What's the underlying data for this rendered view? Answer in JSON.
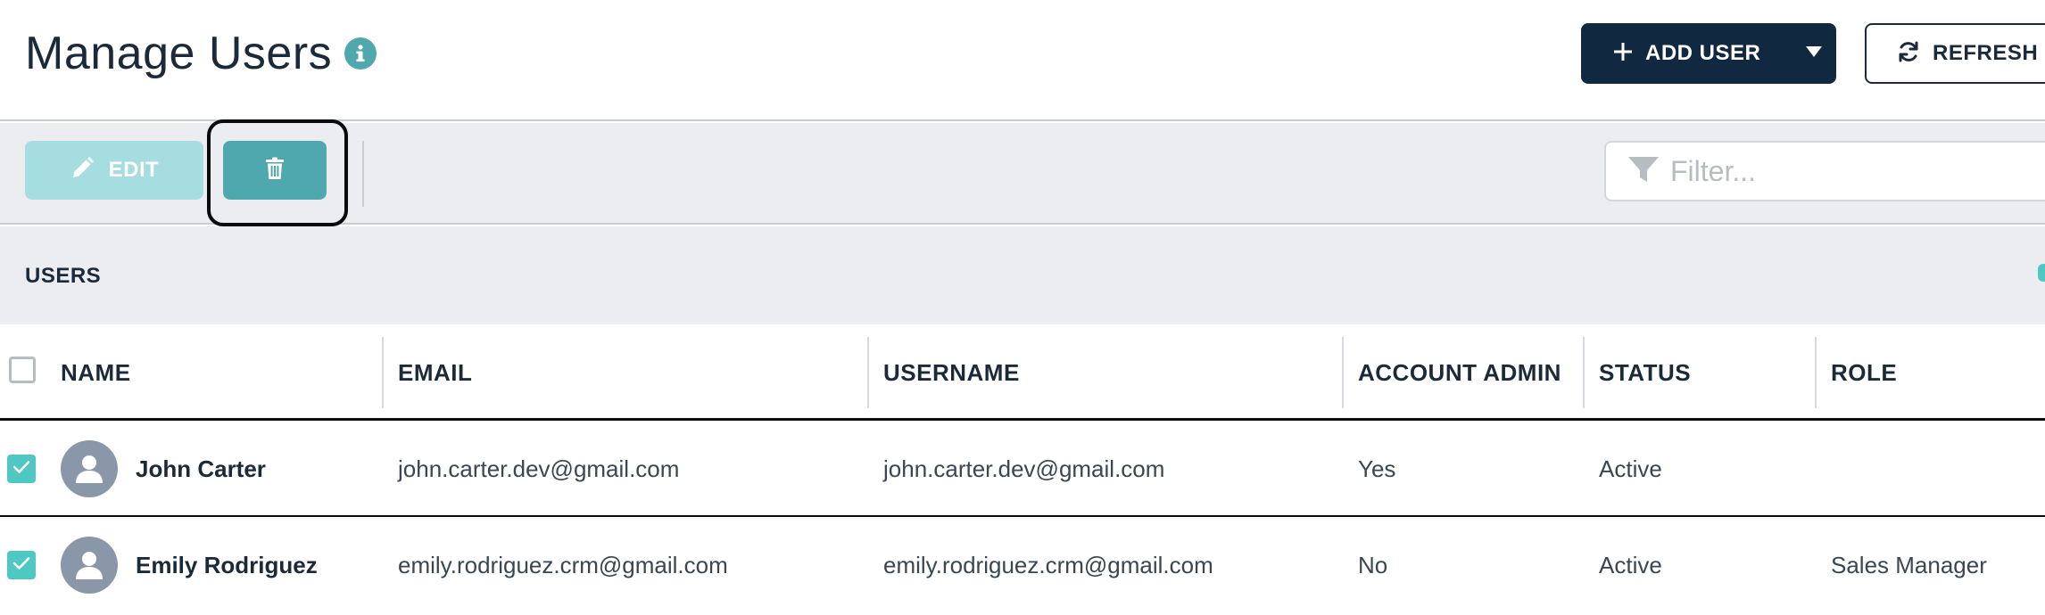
{
  "header": {
    "title": "Manage Users",
    "add_user_label": "ADD USER",
    "refresh_label": "REFRESH"
  },
  "toolbar": {
    "edit_label": "EDIT",
    "filter_placeholder": "Filter..."
  },
  "section": {
    "title": "USERS"
  },
  "table": {
    "columns": [
      "NAME",
      "EMAIL",
      "USERNAME",
      "ACCOUNT ADMIN",
      "STATUS",
      "ROLE"
    ],
    "rows": [
      {
        "selected": true,
        "name": "John Carter",
        "email": "john.carter.dev@gmail.com",
        "username": "john.carter.dev@gmail.com",
        "account_admin": "Yes",
        "status": "Active",
        "role": ""
      },
      {
        "selected": true,
        "name": "Emily Rodriguez",
        "email": "emily.rodriguez.crm@gmail.com",
        "username": "emily.rodriguez.crm@gmail.com",
        "account_admin": "No",
        "status": "Active",
        "role": "Sales Manager"
      }
    ]
  },
  "icons": {
    "info": "info-icon",
    "add": "plus-icon",
    "caret": "caret-down-icon",
    "refresh": "refresh-icon",
    "edit": "pencil-icon",
    "delete": "trash-icon",
    "filter": "filter-icon",
    "check": "check-icon",
    "avatar": "user-avatar-icon"
  },
  "colors": {
    "primary_dark": "#102840",
    "teal": "#4fa8ae",
    "teal_light": "#a6dde0",
    "check_teal": "#4fc7c3",
    "toolbar_bg": "#ebedf1",
    "avatar_gray": "#8a97a8"
  }
}
